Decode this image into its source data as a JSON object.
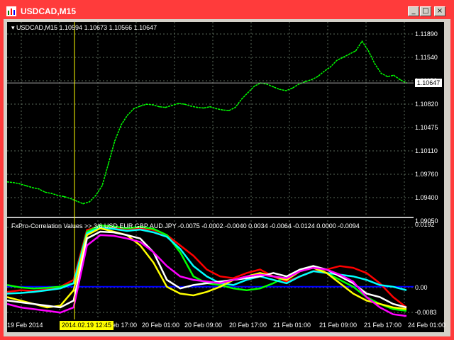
{
  "window": {
    "title": "USDCAD,M15",
    "min_glyph": "_",
    "max_glyph": "□",
    "close_glyph": "×"
  },
  "chart_header": {
    "symbol_line": "▾ USDCAD,M15  1.10594 1.10673 1.10566 1.10647"
  },
  "indicator": {
    "line": "FxPro-Correlation  Values >> 3/6 USD EUR GBP AUD JPY -0.0075 -0.0002 -0.0040 0.0034 -0.0064 -0.0124 0.0000 -0.0094"
  },
  "colors": {
    "frame": "#ff3b3b",
    "price_line": "#00ff00",
    "grid": "#5a6a5a",
    "cursor": "#ffff00",
    "zero_line": "#0000ff"
  },
  "price_axis_labels": [
    "1.11890",
    "1.11540",
    "1.11180",
    "1.10820",
    "1.10475",
    "1.10110",
    "1.09760",
    "1.09400",
    "1.09050"
  ],
  "current_price_label": "1.10647",
  "indicator_axis_labels": [
    "0.0192",
    "0.00",
    "-0.0083"
  ],
  "time_labels": [
    "19 Feb 2014",
    "19 Feb 17:00",
    "20 Feb 01:00",
    "20 Feb 09:00",
    "20 Feb 17:00",
    "21 Feb 01:00",
    "21 Feb 09:00",
    "21 Feb 17:00",
    "24 Feb 01:00"
  ],
  "date_marker": "2014.02.19 12:45",
  "chart_data": [
    {
      "type": "line",
      "xlabel": "",
      "ylabel": "",
      "ylim": [
        1.0905,
        1.1205
      ],
      "grid": true,
      "series": [
        {
          "values": [
            1.0956,
            1.0955,
            1.0953,
            1.095,
            1.0947,
            1.0945,
            1.094,
            1.0938,
            1.0935,
            1.0933,
            1.093,
            1.0926,
            1.0922,
            1.0925,
            1.0935,
            1.095,
            1.0985,
            1.102,
            1.1045,
            1.106,
            1.107,
            1.1074,
            1.1077,
            1.1076,
            1.1073,
            1.1072,
            1.1075,
            1.1078,
            1.1077,
            1.1074,
            1.1072,
            1.1071,
            1.1073,
            1.107,
            1.1068,
            1.1067,
            1.1072,
            1.1085,
            1.1095,
            1.1105,
            1.111,
            1.1108,
            1.1104,
            1.11,
            1.1098,
            1.1102,
            1.1108,
            1.1112,
            1.1115,
            1.112,
            1.1128,
            1.1135,
            1.1145,
            1.115,
            1.1155,
            1.116,
            1.1175,
            1.116,
            1.114,
            1.1125,
            1.112,
            1.1122,
            1.1115,
            1.111
          ]
        }
      ]
    },
    {
      "type": "line",
      "xlabel": "",
      "ylabel": "",
      "ylim": [
        -0.0095,
        0.0195
      ],
      "grid": true,
      "series": [
        {
          "color": "#ff0000",
          "values": [
            -0.0015,
            -0.001,
            -0.0012,
            -0.0008,
            0.0,
            0.002,
            0.0165,
            0.0175,
            0.0172,
            0.0168,
            0.017,
            0.0165,
            0.015,
            0.012,
            0.009,
            0.005,
            0.003,
            0.0025,
            0.004,
            0.005,
            0.003,
            0.0015,
            0.003,
            0.0045,
            0.005,
            0.006,
            0.0055,
            0.004,
            0.001,
            -0.003,
            -0.006
          ]
        },
        {
          "color": "#00ff00",
          "values": [
            0.0005,
            -0.0002,
            -0.0005,
            -0.0003,
            0.0,
            0.001,
            0.016,
            0.0178,
            0.0175,
            0.017,
            0.0174,
            0.0168,
            0.015,
            0.01,
            0.003,
            0.001,
            0.0005,
            -0.0005,
            -0.001,
            -0.0005,
            0.001,
            0.003,
            0.005,
            0.006,
            0.004,
            0.002,
            0.0,
            -0.003,
            -0.005,
            -0.0065,
            -0.007
          ]
        },
        {
          "color": "#00ffff",
          "values": [
            -0.002,
            -0.0018,
            -0.0015,
            -0.001,
            -0.0005,
            0.001,
            0.0155,
            0.0172,
            0.0168,
            0.0162,
            0.0166,
            0.0158,
            0.0145,
            0.011,
            0.006,
            0.003,
            0.001,
            0.0005,
            0.002,
            0.003,
            0.002,
            0.001,
            0.003,
            0.0045,
            0.004,
            0.0035,
            0.003,
            0.002,
            0.0005,
            0.0,
            -0.001
          ]
        },
        {
          "color": "#ffff00",
          "values": [
            -0.003,
            -0.004,
            -0.005,
            -0.006,
            -0.0055,
            -0.001,
            0.015,
            0.017,
            0.016,
            0.015,
            0.012,
            0.007,
            0.0,
            -0.002,
            -0.0025,
            -0.0015,
            0.0,
            0.002,
            0.003,
            0.004,
            0.003,
            0.002,
            0.0045,
            0.0055,
            0.004,
            0.001,
            -0.002,
            -0.004,
            -0.005,
            -0.006,
            -0.0065
          ]
        },
        {
          "color": "#ffffff",
          "values": [
            -0.004,
            -0.0045,
            -0.005,
            -0.0055,
            -0.006,
            -0.004,
            0.014,
            0.016,
            0.0158,
            0.015,
            0.014,
            0.01,
            0.002,
            -0.0005,
            0.0005,
            0.001,
            0.0015,
            0.002,
            0.0025,
            0.003,
            0.004,
            0.003,
            0.005,
            0.006,
            0.005,
            0.003,
            0.001,
            -0.002,
            -0.003,
            -0.005,
            -0.006
          ]
        },
        {
          "color": "#ff00ff",
          "values": [
            -0.005,
            -0.006,
            -0.0065,
            -0.007,
            -0.0075,
            -0.006,
            0.012,
            0.015,
            0.0148,
            0.014,
            0.013,
            0.01,
            0.006,
            0.003,
            0.002,
            0.0015,
            0.001,
            0.002,
            0.003,
            0.0035,
            0.003,
            0.0025,
            0.0045,
            0.0055,
            0.005,
            0.0035,
            0.0015,
            -0.003,
            -0.006,
            -0.008,
            -0.0085
          ]
        }
      ]
    }
  ]
}
